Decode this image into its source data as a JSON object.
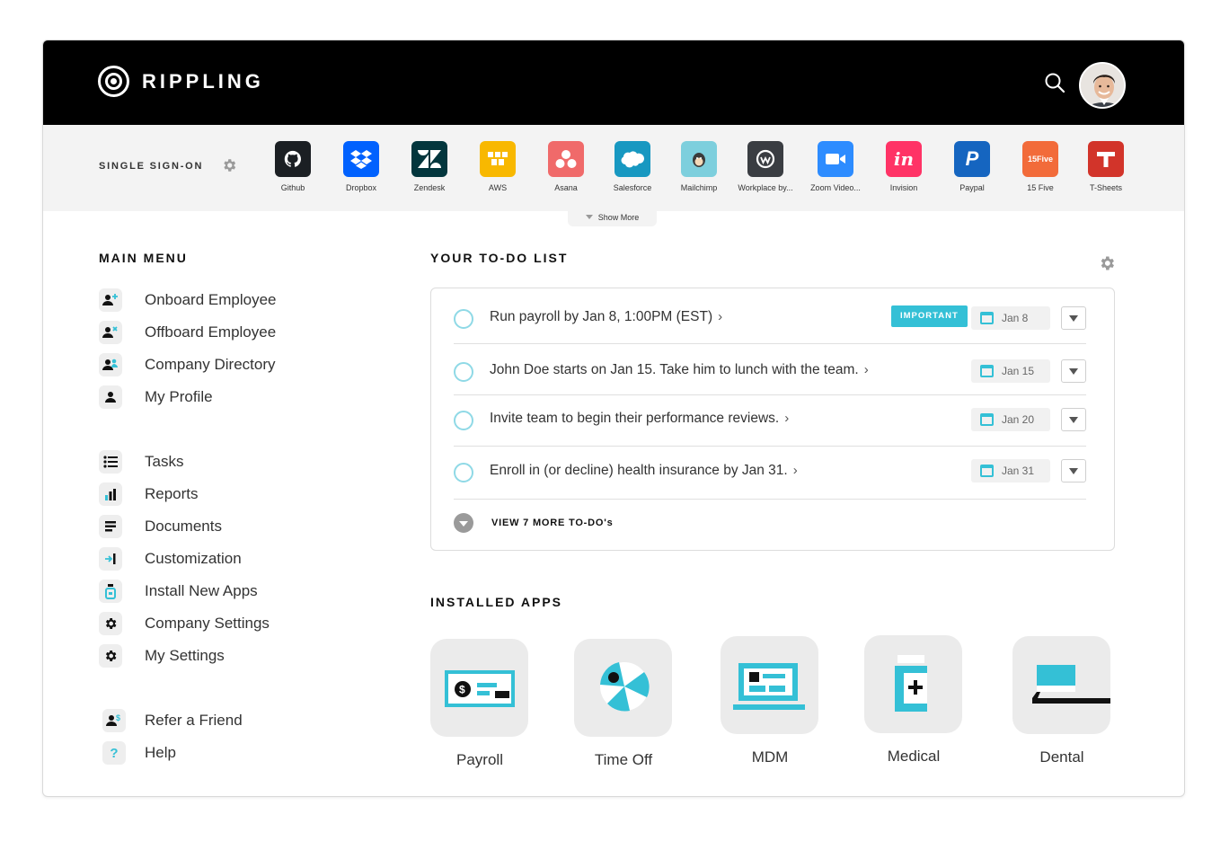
{
  "header": {
    "brand": "RIPPLING",
    "search_icon": "search-icon",
    "avatar": "user-avatar"
  },
  "sso": {
    "title": "SINGLE SIGN-ON",
    "apps": [
      {
        "label": "Github",
        "color": "#1b1f23"
      },
      {
        "label": "Dropbox",
        "color": "#0061fe"
      },
      {
        "label": "Zendesk",
        "color": "#03363d"
      },
      {
        "label": "AWS",
        "color": "#f8b800"
      },
      {
        "label": "Asana",
        "color": "#f06a6a"
      },
      {
        "label": "Salesforce",
        "color": "#1798c1"
      },
      {
        "label": "Mailchimp",
        "color": "#7dcfdd"
      },
      {
        "label": "Workplace by...",
        "color": "#3a3d42"
      },
      {
        "label": "Zoom Video...",
        "color": "#2d8cff"
      },
      {
        "label": "Invision",
        "color": "#ff3366"
      },
      {
        "label": "Paypal",
        "color": "#1565c0"
      },
      {
        "label": "15 Five",
        "color": "#f26b3a"
      },
      {
        "label": "T-Sheets",
        "color": "#d2342a"
      }
    ],
    "show_more": "Show More"
  },
  "main_menu": {
    "title": "MAIN MENU",
    "items": [
      {
        "label": "Onboard Employee",
        "icon": "person-plus-icon"
      },
      {
        "label": "Offboard Employee",
        "icon": "person-x-icon"
      },
      {
        "label": "Company Directory",
        "icon": "people-icon"
      },
      {
        "label": "My Profile",
        "icon": "person-icon"
      },
      {
        "label": "Tasks",
        "icon": "tasks-icon"
      },
      {
        "label": "Reports",
        "icon": "bar-chart-icon"
      },
      {
        "label": "Documents",
        "icon": "documents-icon"
      },
      {
        "label": "Customization",
        "icon": "customization-icon"
      },
      {
        "label": "Install New Apps",
        "icon": "install-apps-icon"
      },
      {
        "label": "Company Settings",
        "icon": "gear-icon"
      },
      {
        "label": "My Settings",
        "icon": "gear-icon"
      },
      {
        "label": "Refer a Friend",
        "icon": "refer-friend-icon"
      },
      {
        "label": "Help",
        "icon": "help-icon"
      }
    ]
  },
  "todo": {
    "title": "YOUR TO-DO LIST",
    "items": [
      {
        "text": "Run payroll by Jan 8, 1:00PM (EST)",
        "badge": "IMPORTANT",
        "date": "Jan 8"
      },
      {
        "text": "John Doe starts on Jan 15. Take him to lunch with the team.",
        "date": "Jan 15"
      },
      {
        "text": "Invite team to begin their performance reviews.",
        "date": "Jan 20"
      },
      {
        "text": "Enroll in (or decline) health insurance by Jan 31.",
        "date": "Jan 31"
      }
    ],
    "view_more": "VIEW 7 MORE TO-DO's"
  },
  "installed_apps": {
    "title": "INSTALLED APPS",
    "items": [
      {
        "label": "Payroll",
        "icon": "payroll-check-icon"
      },
      {
        "label": "Time Off",
        "icon": "beach-ball-icon"
      },
      {
        "label": "MDM",
        "icon": "laptop-icon"
      },
      {
        "label": "Medical",
        "icon": "medicine-bottle-icon"
      },
      {
        "label": "Dental",
        "icon": "dental-chair-icon"
      }
    ]
  },
  "colors": {
    "accent": "#34c0d6",
    "header_bg": "#000000",
    "sso_bg": "#f3f3f3"
  }
}
